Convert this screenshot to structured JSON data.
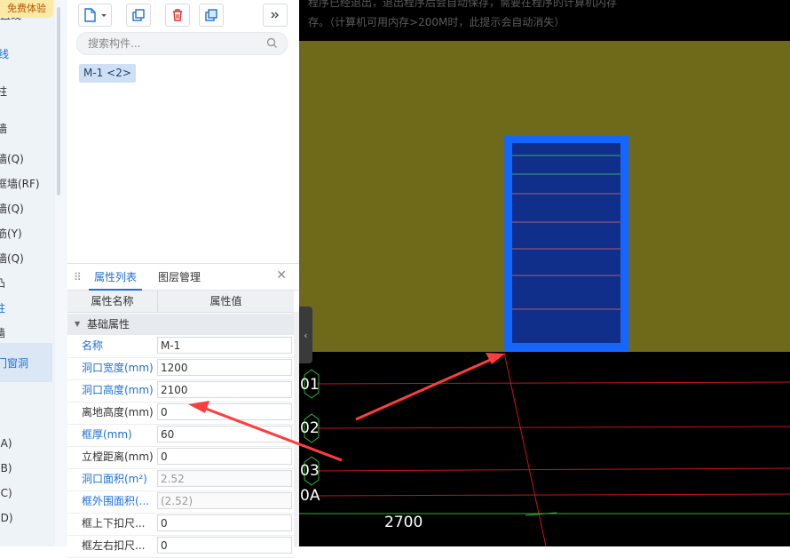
{
  "left_nav": {
    "trial_badge": "免费体验",
    "items": [
      "直线",
      "线",
      "柱",
      "墙",
      "墙(Q)",
      "框墙(RF)",
      "墙(Q)",
      "筋(Y)",
      "墙(Q)",
      "凸",
      "柱",
      "墙",
      "门窗洞",
      "(A)",
      "(B)",
      "(C)",
      "(D)"
    ],
    "selected": "门窗洞"
  },
  "component_panel": {
    "search_placeholder": "搜索构件...",
    "component_tag": "M-1 <2>"
  },
  "properties": {
    "tabs": [
      "属性列表",
      "图层管理"
    ],
    "active_tab": "属性列表",
    "columns": [
      "属性名称",
      "属性值"
    ],
    "group": "基础属性",
    "rows": [
      {
        "name": "名称",
        "value": "M-1",
        "blue": true,
        "grey": false
      },
      {
        "name": "洞口宽度(mm)",
        "value": "1200",
        "blue": true,
        "grey": false
      },
      {
        "name": "洞口高度(mm)",
        "value": "2100",
        "blue": true,
        "grey": false
      },
      {
        "name": "离地高度(mm)",
        "value": "0",
        "blue": false,
        "grey": false
      },
      {
        "name": "框厚(mm)",
        "value": "60",
        "blue": true,
        "grey": false
      },
      {
        "name": "立樘距离(mm)",
        "value": "0",
        "blue": false,
        "grey": false
      },
      {
        "name": "洞口面积(m²)",
        "value": "2.52",
        "blue": true,
        "grey": true
      },
      {
        "name": "框外围面积(...",
        "value": "(2.52)",
        "blue": true,
        "grey": true
      },
      {
        "name": "框上下扣尺...",
        "value": "0",
        "blue": false,
        "grey": false
      },
      {
        "name": "框左右扣尺...",
        "value": "0",
        "blue": false,
        "grey": false
      }
    ]
  },
  "viewport": {
    "hint_line1": "程序已经退出，退出程序后会自动保存，需要在程序的计算机内存",
    "hint_line2": "存。（计算机可用内存>200M时，此提示会自动消失）",
    "axis_labels": [
      "01",
      "02",
      "03",
      "0A"
    ],
    "dimension": "2700",
    "colors": {
      "wall": "#6e6a1a",
      "door_frame": "#1466ff",
      "door_fill": "#0f2f8a",
      "gridline": "#e01414",
      "arrow": "#ff3d3d"
    }
  }
}
